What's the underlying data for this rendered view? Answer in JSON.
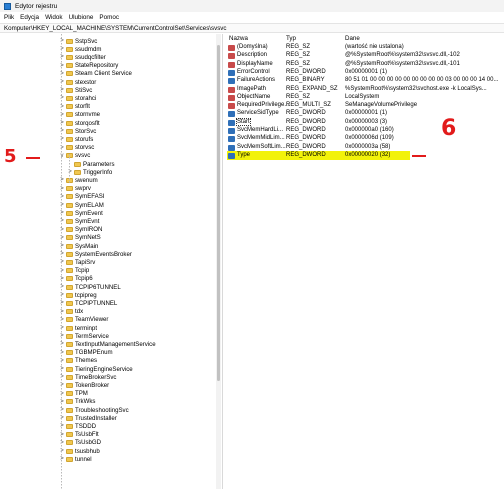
{
  "window": {
    "title": "Edytor rejestru"
  },
  "menu": [
    "Plik",
    "Edycja",
    "Widok",
    "Ulubione",
    "Pomoc"
  ],
  "address": "Komputer\\HKEY_LOCAL_MACHINE\\SYSTEM\\CurrentControlSet\\Services\\svsvc",
  "tree": [
    {
      "label": "SstpSvc",
      "chev": ">"
    },
    {
      "label": "ssudmdm",
      "chev": ">"
    },
    {
      "label": "ssudqcfilter",
      "chev": ">"
    },
    {
      "label": "StateRepository",
      "chev": ">"
    },
    {
      "label": "Steam Client Service",
      "chev": ">"
    },
    {
      "label": "stexstor",
      "chev": ">"
    },
    {
      "label": "StiSvc",
      "chev": ">"
    },
    {
      "label": "storahci",
      "chev": ">"
    },
    {
      "label": "storflt",
      "chev": ">"
    },
    {
      "label": "stornvme",
      "chev": ">"
    },
    {
      "label": "storqosflt",
      "chev": ">"
    },
    {
      "label": "StorSvc",
      "chev": ">"
    },
    {
      "label": "storufs",
      "chev": ">"
    },
    {
      "label": "storvsc",
      "chev": ">"
    },
    {
      "label": "svsvc",
      "chev": "v"
    },
    {
      "label": "Parameters",
      "chev": ""
    },
    {
      "label": "TriggerInfo",
      "chev": ">"
    },
    {
      "label": "swenum",
      "chev": ">"
    },
    {
      "label": "swprv",
      "chev": ">"
    },
    {
      "label": "SymEFASI",
      "chev": ">"
    },
    {
      "label": "SymELAM",
      "chev": ">"
    },
    {
      "label": "SymEvent",
      "chev": ">"
    },
    {
      "label": "SymEvnt",
      "chev": ">"
    },
    {
      "label": "SymIRON",
      "chev": ">"
    },
    {
      "label": "SymNetS",
      "chev": ">"
    },
    {
      "label": "SysMain",
      "chev": ">"
    },
    {
      "label": "SystemEventsBroker",
      "chev": ">"
    },
    {
      "label": "TapiSrv",
      "chev": ">"
    },
    {
      "label": "Tcpip",
      "chev": ">"
    },
    {
      "label": "Tcpip6",
      "chev": ">"
    },
    {
      "label": "TCPIP6TUNNEL",
      "chev": ">"
    },
    {
      "label": "tcpipreg",
      "chev": ">"
    },
    {
      "label": "TCPIPTUNNEL",
      "chev": ">"
    },
    {
      "label": "tdx",
      "chev": ">"
    },
    {
      "label": "TeamViewer",
      "chev": ">"
    },
    {
      "label": "terminpt",
      "chev": ">"
    },
    {
      "label": "TermService",
      "chev": ">"
    },
    {
      "label": "TextInputManagementService",
      "chev": ">"
    },
    {
      "label": "TGBMPEnum",
      "chev": ">"
    },
    {
      "label": "Themes",
      "chev": ">"
    },
    {
      "label": "TieringEngineService",
      "chev": ">"
    },
    {
      "label": "TimeBrokerSvc",
      "chev": ">"
    },
    {
      "label": "TokenBroker",
      "chev": ">"
    },
    {
      "label": "TPM",
      "chev": ">"
    },
    {
      "label": "TrkWks",
      "chev": ">"
    },
    {
      "label": "TroubleshootingSvc",
      "chev": ">"
    },
    {
      "label": "TrustedInstaller",
      "chev": ">"
    },
    {
      "label": "TSDDD",
      "chev": ">"
    },
    {
      "label": "TsUsbFlt",
      "chev": ">"
    },
    {
      "label": "TsUsbGD",
      "chev": ">"
    },
    {
      "label": "tsusbhub",
      "chev": ">"
    },
    {
      "label": "tunnel",
      "chev": ">"
    }
  ],
  "list": {
    "headers": {
      "name": "Nazwa",
      "type": "Typ",
      "data": "Dane"
    },
    "rows": [
      {
        "name": "(Domyślna)",
        "type": "REG_SZ",
        "data": "(wartość nie ustalona)",
        "icon": "sz"
      },
      {
        "name": "Description",
        "type": "REG_SZ",
        "data": "@%SystemRoot%\\system32\\svsvc.dll,-102",
        "icon": "sz"
      },
      {
        "name": "DisplayName",
        "type": "REG_SZ",
        "data": "@%SystemRoot%\\system32\\svsvc.dll,-101",
        "icon": "sz"
      },
      {
        "name": "ErrorControl",
        "type": "REG_DWORD",
        "data": "0x00000001 (1)",
        "icon": "bin"
      },
      {
        "name": "FailureActions",
        "type": "REG_BINARY",
        "data": "80 51 01 00 00 00 00 00 00 00 00 00 03 00 00 00 14 00...",
        "icon": "bin"
      },
      {
        "name": "ImagePath",
        "type": "REG_EXPAND_SZ",
        "data": "%SystemRoot%\\system32\\svchost.exe -k LocalSys...",
        "icon": "sz"
      },
      {
        "name": "ObjectName",
        "type": "REG_SZ",
        "data": "LocalSystem",
        "icon": "sz"
      },
      {
        "name": "RequiredPrivilege...",
        "type": "REG_MULTI_SZ",
        "data": "SeManageVolumePrivilege",
        "icon": "sz"
      },
      {
        "name": "ServiceSidType",
        "type": "REG_DWORD",
        "data": "0x00000001 (1)",
        "icon": "bin"
      },
      {
        "name": "Start",
        "type": "REG_DWORD",
        "data": "0x00000003 (3)",
        "icon": "bin"
      },
      {
        "name": "SvcMemHardLi...",
        "type": "REG_DWORD",
        "data": "0x000000a0 (160)",
        "icon": "bin"
      },
      {
        "name": "SvcMemMidLim...",
        "type": "REG_DWORD",
        "data": "0x0000006d (109)",
        "icon": "bin"
      },
      {
        "name": "SvcMemSoftLim...",
        "type": "REG_DWORD",
        "data": "0x0000003a (58)",
        "icon": "bin"
      },
      {
        "name": "Type",
        "type": "REG_DWORD",
        "data": "0x00000020 (32)",
        "icon": "bin"
      }
    ]
  },
  "annotations": {
    "left": "5",
    "right": "6"
  },
  "colors": {
    "highlight": "#f2f20a",
    "annotation": "#e21b1b",
    "folder": "#f0c750"
  }
}
